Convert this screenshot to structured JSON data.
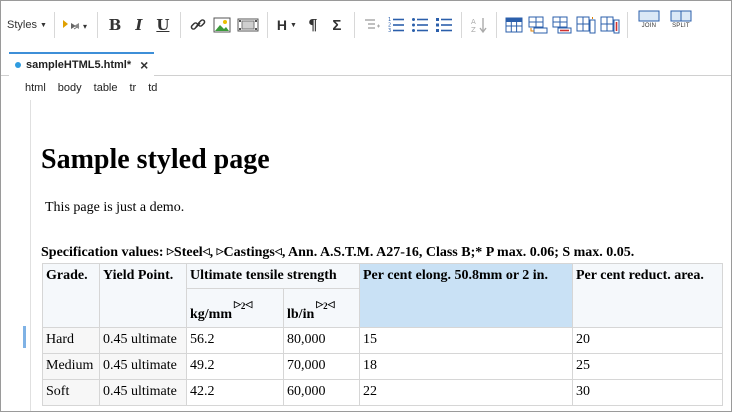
{
  "toolbar": {
    "styles_label": "Styles",
    "heading_label": "H",
    "paragraph_label": "¶",
    "sigma_label": "Σ",
    "join_label": "JOIN",
    "split_label": "SPLIT"
  },
  "tab": {
    "label": "sampleHTML5.html*"
  },
  "breadcrumbs": [
    "html",
    "body",
    "table",
    "tr",
    "td"
  ],
  "document": {
    "title": "Sample styled page",
    "paragraph": "This page is just a demo.",
    "spec_prefix": "Specification values: ",
    "spec_steel": "Steel",
    "spec_sep": ", ",
    "spec_castings": "Castings",
    "spec_suffix": ", Ann. A.S.T.M. A27-16, Class B;* P max. 0.06; S max. 0.05.",
    "table": {
      "h_grade": "Grade.",
      "h_yield": "Yield Point.",
      "h_uts": "Ultimate tensile strength",
      "h_elong": "Per cent elong. 50.8mm or 2 in.",
      "h_reduct": "Per cent reduct. area.",
      "h_kg": "kg/mm",
      "h_lb": "lb/in",
      "h_exp": "2",
      "rows": [
        {
          "grade": "Hard",
          "yield": "0.45 ultimate",
          "kg": "56.2",
          "lb": "80,000",
          "elong": "15",
          "reduct": "20"
        },
        {
          "grade": "Medium",
          "yield": "0.45 ultimate",
          "kg": "49.2",
          "lb": "70,000",
          "elong": "18",
          "reduct": "25"
        },
        {
          "grade": "Soft",
          "yield": "0.45 ultimate",
          "kg": "42.2",
          "lb": "60,000",
          "elong": "22",
          "reduct": "30"
        }
      ]
    }
  }
}
